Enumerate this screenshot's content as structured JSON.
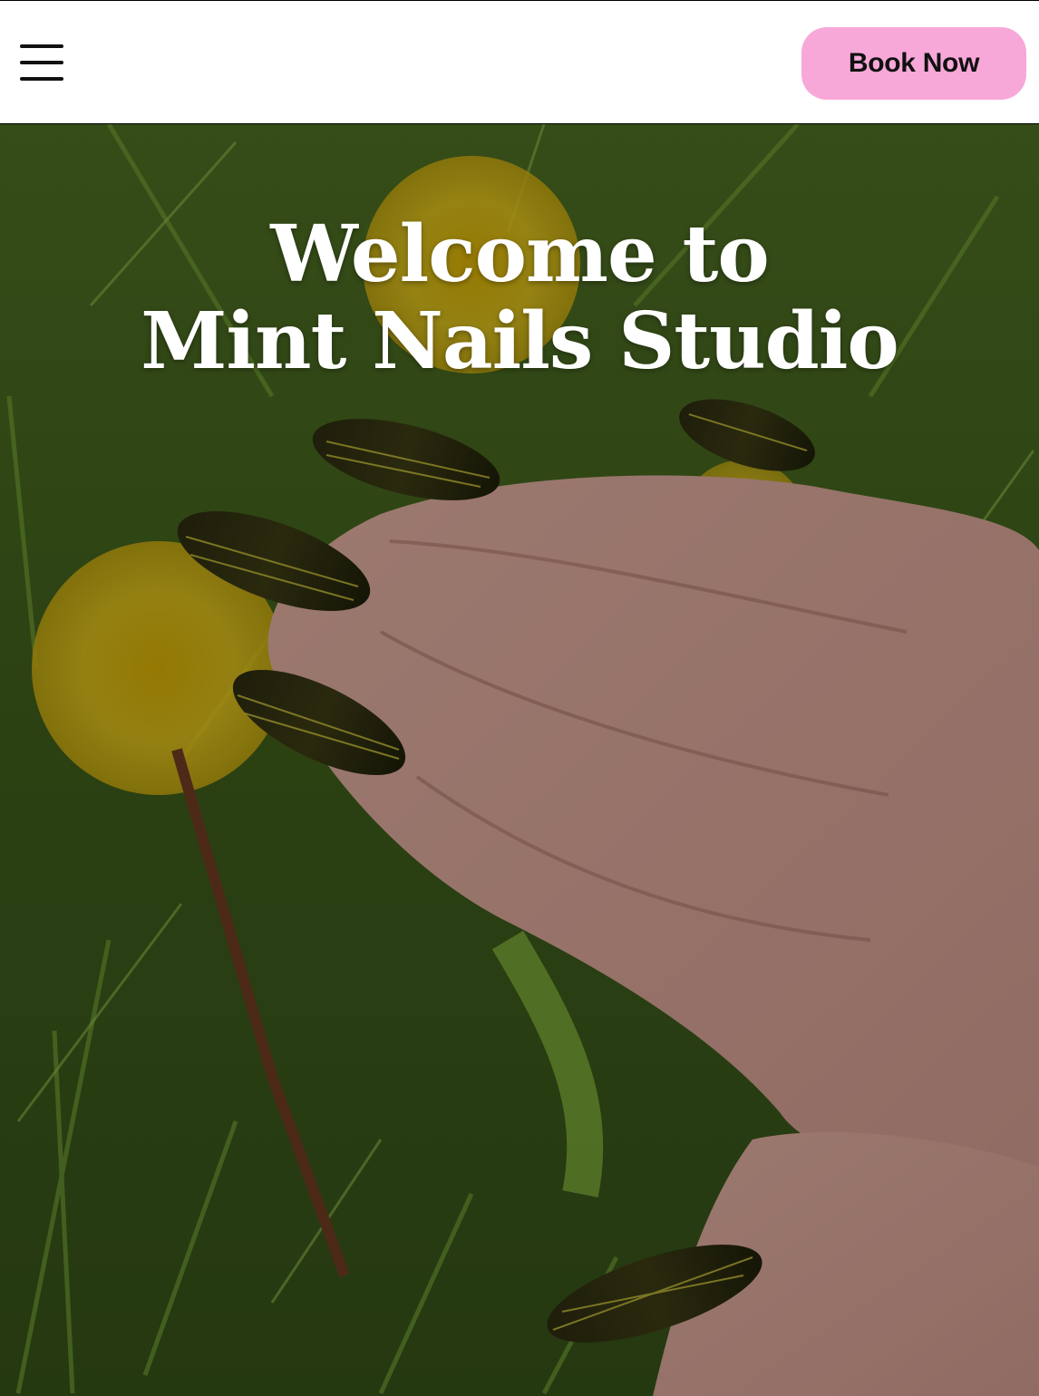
{
  "header": {
    "menu_icon": "hamburger-menu-icon",
    "book_label": "Book Now",
    "book_color": "#f7a8d8"
  },
  "hero": {
    "title_line1": "Welcome to",
    "title_line2": "Mint Nails Studio",
    "background_image": "hand with dark gold-streaked almond nails resting on grass with yellow dandelions"
  }
}
